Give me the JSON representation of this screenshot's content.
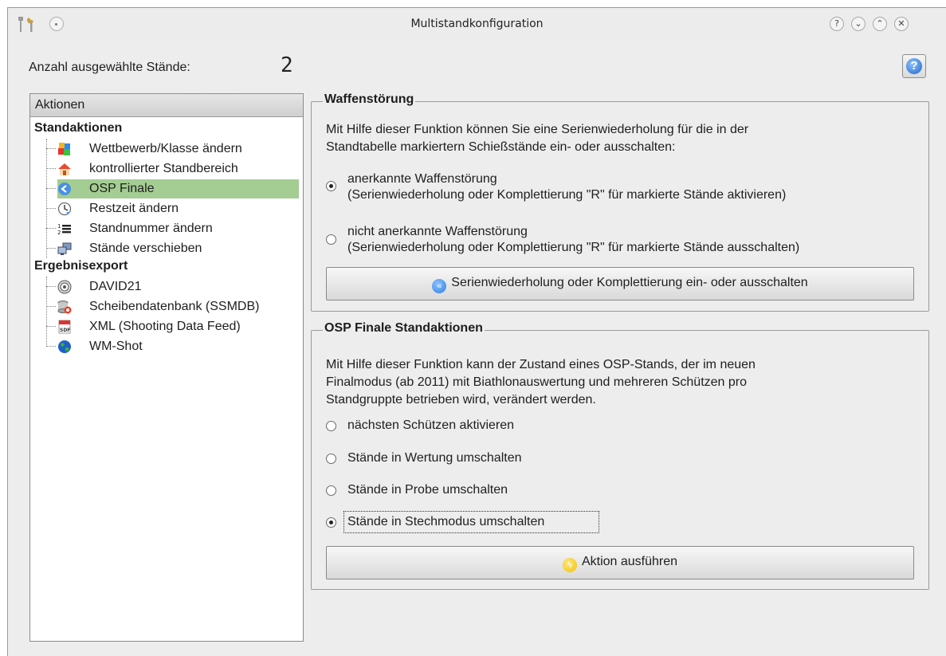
{
  "window": {
    "title": "Multistandkonfiguration"
  },
  "titlebar_buttons": [
    "?",
    "⌄",
    "⌃",
    "✕"
  ],
  "selection": {
    "label": "Anzahl ausgewählte Stände:",
    "count": "2"
  },
  "help_button": {
    "glyph": "?"
  },
  "tree": {
    "header": "Aktionen",
    "groups": [
      {
        "label": "Standaktionen",
        "items": [
          {
            "label": "Wettbewerb/Klasse ändern",
            "icon": "blocks-icon"
          },
          {
            "label": "kontrollierter Standbereich",
            "icon": "house-icon"
          },
          {
            "label": "OSP Finale",
            "icon": "back-arrow-icon",
            "selected": true
          },
          {
            "label": "Restzeit ändern",
            "icon": "clock-icon"
          },
          {
            "label": "Standnummer ändern",
            "icon": "numbered-list-icon"
          },
          {
            "label": "Stände verschieben",
            "icon": "monitors-icon"
          }
        ]
      },
      {
        "label": "Ergebnisexport",
        "items": [
          {
            "label": "DAVID21",
            "icon": "disc-icon"
          },
          {
            "label": "Scheibendatenbank (SSMDB)",
            "icon": "database-icon"
          },
          {
            "label": "XML (Shooting Data Feed)",
            "icon": "sdf-file-icon"
          },
          {
            "label": "WM-Shot",
            "icon": "globe-icon"
          }
        ]
      }
    ]
  },
  "waffenstoerung": {
    "title": "Waffenstörung",
    "description_line1": "Mit Hilfe dieser Funktion können Sie eine Serienwiederholung für die in der",
    "description_line2": "Standtabelle markiertern Schießstände ein- oder ausschalten:",
    "option1_line1": "anerkannte Waffenstörung",
    "option1_line2": "(Serienwiederholung oder Komplettierung \"R\" für markierte Stände aktivieren)",
    "option1_checked": true,
    "option2_line1": "nicht anerkannte Waffenstörung",
    "option2_line2": "(Serienwiederholung oder Komplettierung \"R\" für markierte Stände ausschalten)",
    "option2_checked": false,
    "button_label": "Serienwiederholung oder Komplettierung ein- oder ausschalten"
  },
  "osp_finale": {
    "title": "OSP Finale Standaktionen",
    "description_line1": "Mit Hilfe dieser Funktion kann der Zustand eines OSP-Stands, der im neuen",
    "description_line2": "Finalmodus (ab 2011) mit Biathlonauswertung und mehreren Schützen pro",
    "description_line3": "Standgruppte betrieben wird, verändert werden.",
    "options": [
      {
        "label": "nächsten Schützen aktivieren",
        "checked": false
      },
      {
        "label": "Stände in Wertung umschalten",
        "checked": false
      },
      {
        "label": "Stände in Probe umschalten",
        "checked": false
      },
      {
        "label": "Stände in Stechmodus umschalten",
        "checked": true
      }
    ],
    "button_label": "Aktion ausführen"
  },
  "colors": {
    "window_bg": "#ededed",
    "selection_bg": "#a3cd92",
    "accent_blue": "#2f7fe0",
    "accent_yellow": "#f2c200"
  }
}
